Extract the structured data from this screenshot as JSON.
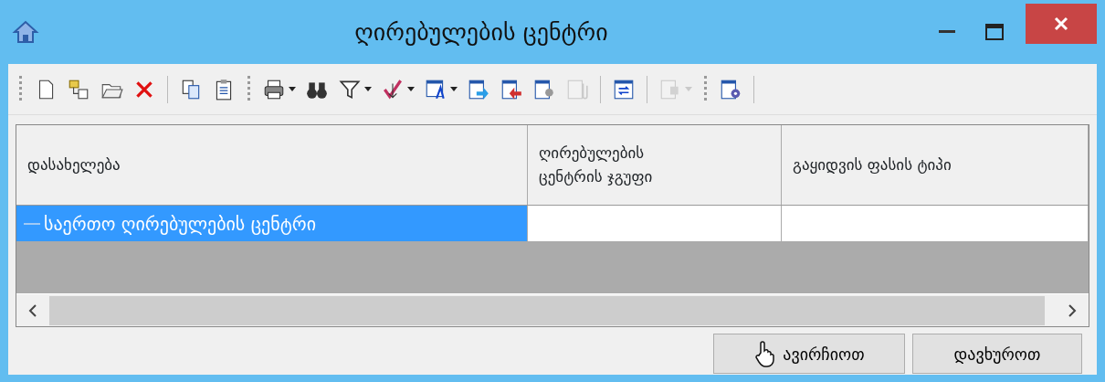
{
  "window": {
    "title": "ღირებულების ცენტრი"
  },
  "toolbar": [
    {
      "kind": "new",
      "disabled": false,
      "dropdown": false
    },
    {
      "kind": "tree",
      "disabled": false,
      "dropdown": false
    },
    {
      "kind": "open",
      "disabled": false,
      "dropdown": false
    },
    {
      "kind": "delete",
      "disabled": false,
      "dropdown": false
    },
    {
      "kind": "sep"
    },
    {
      "kind": "copy",
      "disabled": false,
      "dropdown": false
    },
    {
      "kind": "paste",
      "disabled": false,
      "dropdown": false
    },
    {
      "kind": "grip"
    },
    {
      "kind": "print",
      "disabled": false,
      "dropdown": true
    },
    {
      "kind": "find",
      "disabled": false,
      "dropdown": false
    },
    {
      "kind": "filter",
      "disabled": false,
      "dropdown": true
    },
    {
      "kind": "check",
      "disabled": false,
      "dropdown": true
    },
    {
      "kind": "format",
      "disabled": false,
      "dropdown": true
    },
    {
      "kind": "export",
      "disabled": false,
      "dropdown": false
    },
    {
      "kind": "import",
      "disabled": false,
      "dropdown": false
    },
    {
      "kind": "view",
      "disabled": false,
      "dropdown": false
    },
    {
      "kind": "attach",
      "disabled": true,
      "dropdown": false
    },
    {
      "kind": "sep"
    },
    {
      "kind": "refresh",
      "disabled": false,
      "dropdown": false
    },
    {
      "kind": "sep"
    },
    {
      "kind": "props",
      "disabled": true,
      "dropdown": true
    },
    {
      "kind": "grip"
    },
    {
      "kind": "settings",
      "disabled": false,
      "dropdown": false
    },
    {
      "kind": "sep"
    }
  ],
  "table": {
    "columns": [
      "დასახელება",
      "ღირებულების ცენტრის ჯგუფი",
      "გაყიდვის ფასის ტიპი"
    ],
    "rows": [
      {
        "name": "საერთო ღირებულების ცენტრი",
        "selected": true
      }
    ]
  },
  "buttons": [
    {
      "label": "ავირჩიოთ"
    },
    {
      "label": "დავხუროთ"
    }
  ]
}
